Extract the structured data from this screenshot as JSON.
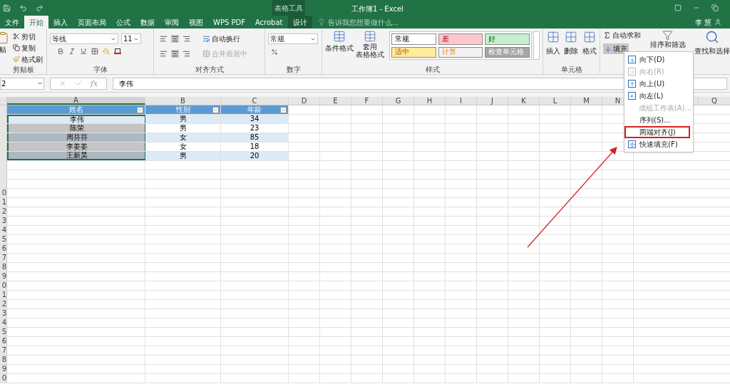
{
  "title_bar": {
    "contextual_group": "表格工具",
    "title": "工作簿1 - Excel",
    "user": "李 慧"
  },
  "tabs": [
    {
      "label": "文件",
      "selected": false
    },
    {
      "label": "开始",
      "selected": true
    },
    {
      "label": "插入",
      "selected": false
    },
    {
      "label": "页面布局",
      "selected": false
    },
    {
      "label": "公式",
      "selected": false
    },
    {
      "label": "数据",
      "selected": false
    },
    {
      "label": "审阅",
      "selected": false
    },
    {
      "label": "视图",
      "selected": false
    },
    {
      "label": "WPS PDF",
      "selected": false
    },
    {
      "label": "Acrobat",
      "selected": false
    },
    {
      "label": "设计",
      "selected": false,
      "kind": "contextual"
    }
  ],
  "tell_me": {
    "placeholder": "告诉我您想要做什么..."
  },
  "ribbon": {
    "clipboard": {
      "label": "剪贴板",
      "paste": "贴",
      "cut": "剪切",
      "copy": "复制",
      "format_painter": "格式刷"
    },
    "font": {
      "label": "字体",
      "name": "等线",
      "size": "11"
    },
    "alignment": {
      "label": "对齐方式",
      "wrap": "自动换行",
      "merge": "合并后居中",
      "merge_disabled": true
    },
    "number": {
      "label": "数字",
      "format": "常规"
    },
    "styles": {
      "label": "样式",
      "conditional": "条件格式",
      "table_format_1": "套用",
      "table_format_2": "表格格式",
      "gallery": [
        {
          "text": "常规",
          "kind": "normal"
        },
        {
          "text": "差",
          "kind": "bad"
        },
        {
          "text": "好",
          "kind": "good"
        },
        {
          "text": "适中",
          "kind": "neutral"
        },
        {
          "text": "计算",
          "kind": "calculation"
        },
        {
          "text": "检查单元格",
          "kind": "check"
        }
      ]
    },
    "cells": {
      "label": "单元格",
      "insert": "插入",
      "delete": "删除",
      "format": "格式"
    },
    "editing": {
      "autosum": "自动求和",
      "fill": "填充",
      "sort": "排序和筛选",
      "find": "查找和选择"
    }
  },
  "formula_bar": {
    "name_box": "2",
    "function_label": "fx",
    "formula": "李伟"
  },
  "column_headers": [
    {
      "label": "A",
      "selected": true
    },
    {
      "label": "B",
      "selected": false
    },
    {
      "label": "C",
      "selected": false
    },
    {
      "label": "D",
      "selected": false
    },
    {
      "label": "E",
      "selected": false
    },
    {
      "label": "F",
      "selected": false
    },
    {
      "label": "G",
      "selected": false
    },
    {
      "label": "H",
      "selected": false
    },
    {
      "label": "I",
      "selected": false
    },
    {
      "label": "J",
      "selected": false
    },
    {
      "label": "K",
      "selected": false
    },
    {
      "label": "L",
      "selected": false
    },
    {
      "label": "M",
      "selected": false
    },
    {
      "label": "N",
      "selected": false
    }
  ],
  "last_column_header": {
    "label": "Q",
    "selected": false
  },
  "row_headers": [
    "0",
    "1",
    "2",
    "3",
    "4",
    "5",
    "6",
    "7",
    "8",
    "9",
    "0",
    "1",
    "2",
    "3",
    "4",
    "5",
    "6",
    "7",
    "8",
    "9",
    "0"
  ],
  "table": {
    "columns": [
      "姓名",
      "性别",
      "年龄"
    ],
    "rows": [
      [
        {
          "text": "李伟",
          "selected": true,
          "active": true
        },
        {
          "text": "男",
          "selected": false
        },
        {
          "text": "34",
          "selected": false
        }
      ],
      [
        {
          "text": "陈荣",
          "selected": true,
          "active": false
        },
        {
          "text": "男",
          "selected": false
        },
        {
          "text": "23",
          "selected": false
        }
      ],
      [
        {
          "text": "周芬芬",
          "selected": true,
          "active": false
        },
        {
          "text": "女",
          "selected": false
        },
        {
          "text": "85",
          "selected": false
        }
      ],
      [
        {
          "text": "李姜姜",
          "selected": true,
          "active": false
        },
        {
          "text": "女",
          "selected": false
        },
        {
          "text": "18",
          "selected": false
        }
      ],
      [
        {
          "text": "王新昊",
          "selected": true,
          "active": false
        },
        {
          "text": "男",
          "selected": false
        },
        {
          "text": "20",
          "selected": false
        }
      ]
    ]
  },
  "fill_menu": [
    {
      "label": "向下(D)",
      "kind": "down",
      "disabled": false,
      "highlighted": false
    },
    {
      "label": "向右(R)",
      "kind": "right",
      "disabled": true,
      "highlighted": false
    },
    {
      "label": "向上(U)",
      "kind": "up",
      "disabled": false,
      "highlighted": false
    },
    {
      "label": "向左(L)",
      "kind": "left",
      "disabled": false,
      "highlighted": false
    },
    {
      "label": "成组工作表(A)...",
      "kind": "none",
      "disabled": true,
      "highlighted": false
    },
    {
      "label": "序列(S)...",
      "kind": "none",
      "disabled": false,
      "highlighted": false
    },
    {
      "label": "两端对齐(J)",
      "kind": "none",
      "disabled": false,
      "highlighted": true
    },
    {
      "label": "快速填充(F)",
      "kind": "flash",
      "disabled": false,
      "highlighted": false
    }
  ],
  "annotation_arrow": true
}
